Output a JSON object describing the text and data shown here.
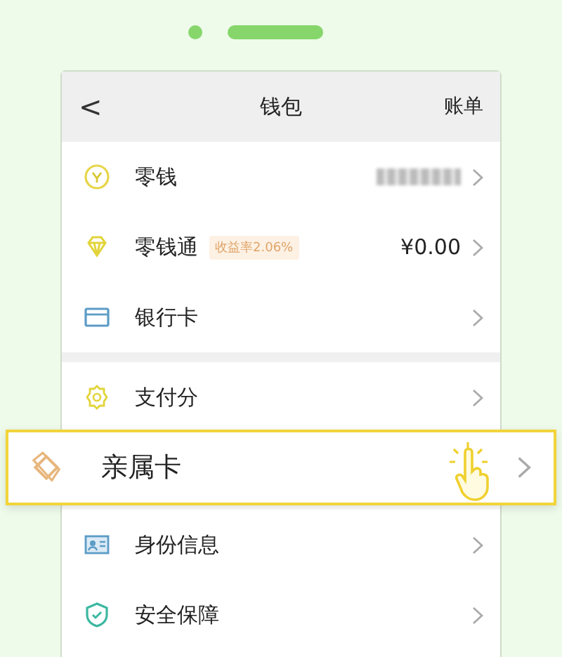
{
  "header": {
    "back": "<",
    "title": "钱包",
    "action": "账单"
  },
  "sections": [
    {
      "rows": [
        {
          "label": "零钱",
          "masked_value": true,
          "highlighted": false
        },
        {
          "label": "零钱通",
          "badge": "收益率2.06%",
          "value": "¥0.00",
          "highlighted": false
        },
        {
          "label": "银行卡",
          "highlighted": false
        }
      ]
    },
    {
      "rows": [
        {
          "label": "支付分",
          "highlighted": false
        },
        {
          "label": "亲属卡",
          "highlighted": true
        },
        {
          "label": "身份信息",
          "highlighted": false
        },
        {
          "label": "安全保障",
          "highlighted": false
        }
      ]
    }
  ]
}
